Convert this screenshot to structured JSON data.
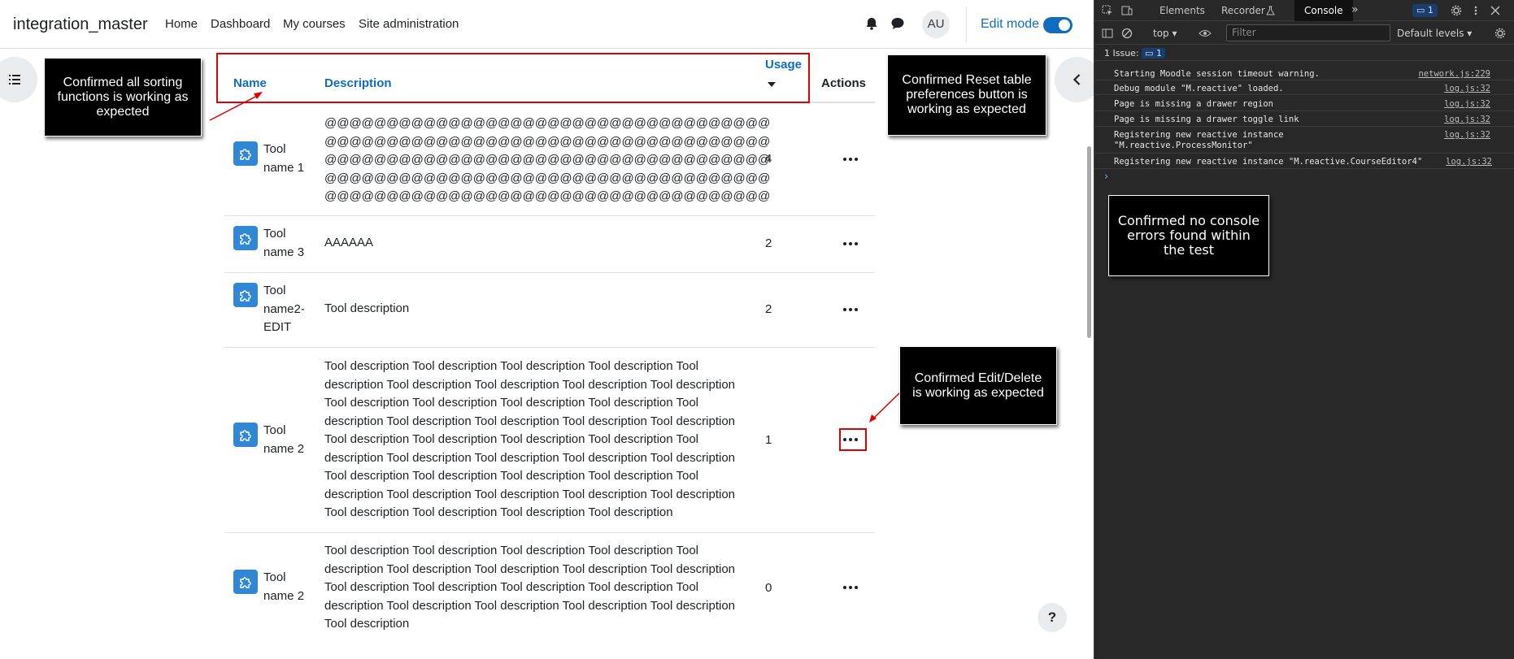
{
  "navbar": {
    "brand": "integration_master",
    "links": [
      "Home",
      "Dashboard",
      "My courses",
      "Site administration"
    ],
    "avatar": "AU",
    "edit_mode_label": "Edit mode"
  },
  "table": {
    "headers": {
      "name": "Name",
      "description": "Description",
      "usage": "Usage",
      "actions": "Actions"
    },
    "rows": [
      {
        "name_lines": [
          "Tool",
          "name 1"
        ],
        "description_lines": [
          "@@@@@@@@@@@@@@@@@@@@@@@@@@@@@@@@@@@@",
          "@@@@@@@@@@@@@@@@@@@@@@@@@@@@@@@@@@@@",
          "@@@@@@@@@@@@@@@@@@@@@@@@@@@@@@@@@@@@",
          "@@@@@@@@@@@@@@@@@@@@@@@@@@@@@@@@@@@@",
          "@@@@@@@@@@@@@@@@@@@@@@@@@@@@@@@@@@@@"
        ],
        "usage": "4"
      },
      {
        "name_lines": [
          "Tool",
          "name 3"
        ],
        "description_lines": [
          "AAAAAA"
        ],
        "usage": "2"
      },
      {
        "name_lines": [
          "Tool",
          "name2-",
          "EDIT"
        ],
        "description_lines": [
          "Tool description"
        ],
        "usage": "2"
      },
      {
        "name_lines": [
          "Tool",
          "name 2"
        ],
        "description_lines": [
          "Tool description Tool description Tool description Tool description Tool",
          "description Tool description Tool description Tool description Tool description",
          "Tool description Tool description Tool description Tool description Tool",
          "description Tool description Tool description Tool description Tool description",
          "Tool description Tool description Tool description Tool description Tool",
          "description Tool description Tool description Tool description Tool description",
          "Tool description Tool description Tool description Tool description Tool",
          "description Tool description Tool description Tool description Tool description",
          "Tool description Tool description Tool description Tool description"
        ],
        "usage": "1"
      },
      {
        "name_lines": [
          "Tool",
          "name 2"
        ],
        "description_lines": [
          "Tool description Tool description Tool description Tool description Tool",
          "description Tool description Tool description Tool description Tool description",
          "Tool description Tool description Tool description Tool description Tool",
          "description Tool description Tool description Tool description Tool description",
          "Tool description"
        ],
        "usage": "0"
      }
    ]
  },
  "help_button": "?",
  "annotations": {
    "sorting": "Confirmed all sorting functions is working as expected",
    "reset": "Confirmed Reset table preferences button is working as expected",
    "edit_delete": "Confirmed Edit/Delete is working as expected",
    "console": "Confirmed no console errors found within the test"
  },
  "devtools": {
    "tabs": [
      "Elements",
      "Recorder",
      "Console"
    ],
    "active_tab": "Console",
    "issue_badge": "1",
    "context": "top",
    "filter_placeholder": "Filter",
    "levels": "Default levels",
    "issues_text": "1 Issue:",
    "issues_count": "1",
    "messages": [
      {
        "text": "Starting Moodle session timeout warning.",
        "source": "network.js:229"
      },
      {
        "text": "Debug module \"M.reactive\" loaded.",
        "source": "log.js:32"
      },
      {
        "text": "Page is missing a drawer region",
        "source": "log.js:32"
      },
      {
        "text": "Page is missing a drawer toggle link",
        "source": "log.js:32"
      },
      {
        "text": "Registering new reactive instance\n\"M.reactive.ProcessMonitor\"",
        "source": "log.js:32"
      },
      {
        "text": "Registering new reactive instance \"M.reactive.CourseEditor4\"",
        "source": "log.js:32"
      }
    ]
  },
  "colors": {
    "link_blue": "#0f6cbf",
    "tool_icon_blue": "#2f87d6",
    "annotation_red": "#e00000",
    "devtools_bg": "#282828"
  }
}
